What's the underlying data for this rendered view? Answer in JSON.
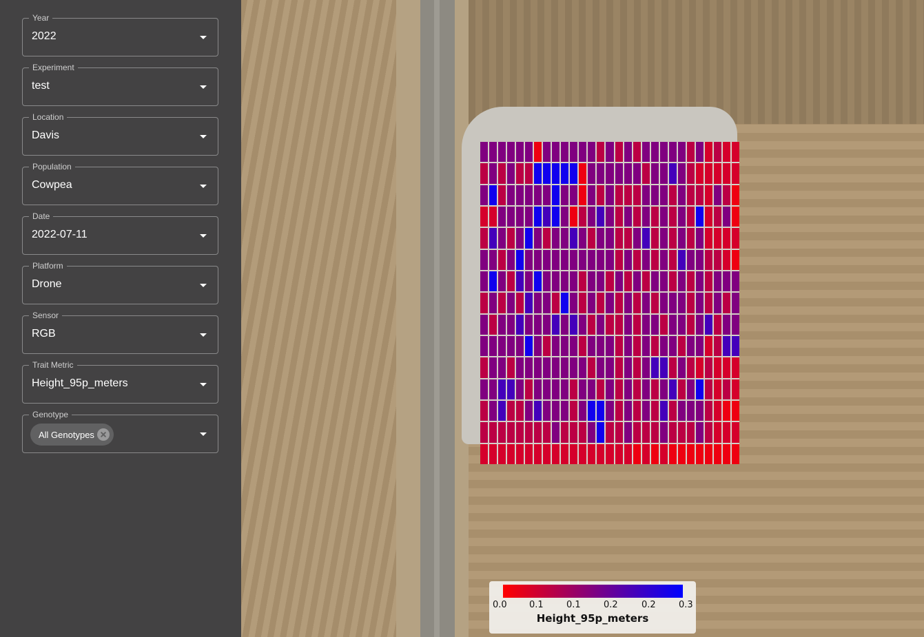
{
  "filters": [
    {
      "label": "Year",
      "value": "2022"
    },
    {
      "label": "Experiment",
      "value": "test"
    },
    {
      "label": "Location",
      "value": "Davis"
    },
    {
      "label": "Population",
      "value": "Cowpea"
    },
    {
      "label": "Date",
      "value": "2022-07-11"
    },
    {
      "label": "Platform",
      "value": "Drone"
    },
    {
      "label": "Sensor",
      "value": "RGB"
    },
    {
      "label": "Trait Metric",
      "value": "Height_95p_meters"
    }
  ],
  "genotype": {
    "label": "Genotype",
    "chip": "All Genotypes"
  },
  "icons": {
    "dropdown": "caret-down-icon",
    "chip_remove": "close-circle-icon"
  },
  "legend": {
    "title": "Height_95p_meters",
    "ticks": [
      "0.0",
      "0.1",
      "0.1",
      "0.2",
      "0.2",
      "0.3"
    ],
    "colors": {
      "low": "#ff0000",
      "mid": "#800080",
      "high": "#0000ff"
    }
  },
  "chart_data": {
    "type": "heatmap",
    "metric": "Height_95p_meters",
    "range": [
      0.0,
      0.3
    ],
    "rows": 15,
    "cols": 29,
    "values": [
      [
        0.15,
        0.15,
        0.15,
        0.15,
        0.15,
        0.15,
        0.02,
        0.15,
        0.15,
        0.15,
        0.15,
        0.15,
        0.15,
        0.08,
        0.15,
        0.08,
        0.15,
        0.08,
        0.15,
        0.15,
        0.15,
        0.15,
        0.15,
        0.08,
        0.15,
        0.05,
        0.08,
        0.05,
        0.05
      ],
      [
        0.08,
        0.15,
        0.08,
        0.15,
        0.08,
        0.08,
        0.28,
        0.28,
        0.28,
        0.28,
        0.28,
        0.02,
        0.15,
        0.15,
        0.15,
        0.15,
        0.15,
        0.15,
        0.08,
        0.15,
        0.15,
        0.22,
        0.15,
        0.08,
        0.05,
        0.05,
        0.05,
        0.05,
        0.05
      ],
      [
        0.15,
        0.28,
        0.08,
        0.15,
        0.15,
        0.15,
        0.15,
        0.15,
        0.28,
        0.15,
        0.15,
        0.02,
        0.15,
        0.08,
        0.15,
        0.08,
        0.08,
        0.08,
        0.15,
        0.15,
        0.15,
        0.08,
        0.15,
        0.08,
        0.08,
        0.05,
        0.15,
        0.08,
        0.02
      ],
      [
        0.05,
        0.05,
        0.15,
        0.15,
        0.15,
        0.15,
        0.28,
        0.22,
        0.28,
        0.15,
        0.02,
        0.08,
        0.15,
        0.22,
        0.15,
        0.08,
        0.15,
        0.08,
        0.15,
        0.08,
        0.15,
        0.08,
        0.15,
        0.08,
        0.28,
        0.05,
        0.08,
        0.15,
        0.02
      ],
      [
        0.08,
        0.22,
        0.15,
        0.08,
        0.15,
        0.28,
        0.15,
        0.08,
        0.15,
        0.15,
        0.22,
        0.15,
        0.08,
        0.15,
        0.15,
        0.08,
        0.08,
        0.15,
        0.22,
        0.08,
        0.15,
        0.08,
        0.15,
        0.08,
        0.15,
        0.05,
        0.05,
        0.05,
        0.05
      ],
      [
        0.15,
        0.15,
        0.08,
        0.15,
        0.28,
        0.15,
        0.15,
        0.15,
        0.15,
        0.15,
        0.15,
        0.15,
        0.15,
        0.15,
        0.15,
        0.08,
        0.15,
        0.08,
        0.15,
        0.08,
        0.15,
        0.08,
        0.22,
        0.15,
        0.15,
        0.08,
        0.08,
        0.05,
        0.02
      ],
      [
        0.15,
        0.28,
        0.15,
        0.08,
        0.22,
        0.15,
        0.28,
        0.15,
        0.15,
        0.15,
        0.15,
        0.08,
        0.15,
        0.15,
        0.08,
        0.15,
        0.08,
        0.15,
        0.08,
        0.15,
        0.15,
        0.08,
        0.15,
        0.08,
        0.15,
        0.08,
        0.15,
        0.15,
        0.15
      ],
      [
        0.08,
        0.15,
        0.08,
        0.15,
        0.08,
        0.22,
        0.15,
        0.15,
        0.08,
        0.28,
        0.15,
        0.08,
        0.15,
        0.08,
        0.15,
        0.08,
        0.15,
        0.08,
        0.15,
        0.08,
        0.15,
        0.15,
        0.15,
        0.08,
        0.15,
        0.08,
        0.15,
        0.08,
        0.15
      ],
      [
        0.15,
        0.08,
        0.15,
        0.15,
        0.22,
        0.15,
        0.15,
        0.15,
        0.22,
        0.15,
        0.22,
        0.15,
        0.08,
        0.15,
        0.08,
        0.08,
        0.15,
        0.08,
        0.15,
        0.15,
        0.08,
        0.15,
        0.15,
        0.08,
        0.15,
        0.22,
        0.08,
        0.15,
        0.15
      ],
      [
        0.15,
        0.15,
        0.15,
        0.15,
        0.15,
        0.28,
        0.15,
        0.08,
        0.15,
        0.15,
        0.15,
        0.08,
        0.15,
        0.15,
        0.15,
        0.08,
        0.15,
        0.08,
        0.15,
        0.08,
        0.15,
        0.15,
        0.08,
        0.15,
        0.15,
        0.05,
        0.08,
        0.22,
        0.22
      ],
      [
        0.08,
        0.15,
        0.15,
        0.08,
        0.15,
        0.15,
        0.15,
        0.15,
        0.15,
        0.15,
        0.15,
        0.15,
        0.08,
        0.15,
        0.15,
        0.08,
        0.15,
        0.08,
        0.15,
        0.22,
        0.22,
        0.08,
        0.15,
        0.08,
        0.05,
        0.08,
        0.05,
        0.05,
        0.05
      ],
      [
        0.15,
        0.15,
        0.22,
        0.22,
        0.15,
        0.08,
        0.15,
        0.15,
        0.15,
        0.15,
        0.08,
        0.15,
        0.15,
        0.08,
        0.15,
        0.08,
        0.15,
        0.08,
        0.15,
        0.08,
        0.15,
        0.22,
        0.08,
        0.15,
        0.28,
        0.08,
        0.05,
        0.08,
        0.05
      ],
      [
        0.08,
        0.15,
        0.22,
        0.08,
        0.08,
        0.15,
        0.22,
        0.15,
        0.15,
        0.15,
        0.08,
        0.15,
        0.28,
        0.28,
        0.15,
        0.08,
        0.15,
        0.08,
        0.15,
        0.08,
        0.22,
        0.08,
        0.15,
        0.15,
        0.15,
        0.08,
        0.05,
        0.02,
        0.02
      ],
      [
        0.08,
        0.08,
        0.08,
        0.08,
        0.08,
        0.08,
        0.08,
        0.08,
        0.15,
        0.08,
        0.08,
        0.08,
        0.15,
        0.28,
        0.08,
        0.08,
        0.15,
        0.08,
        0.08,
        0.08,
        0.15,
        0.08,
        0.08,
        0.08,
        0.15,
        0.08,
        0.05,
        0.05,
        0.05
      ],
      [
        0.05,
        0.05,
        0.05,
        0.05,
        0.05,
        0.05,
        0.05,
        0.05,
        0.05,
        0.05,
        0.05,
        0.05,
        0.05,
        0.05,
        0.05,
        0.05,
        0.05,
        0.02,
        0.05,
        0.02,
        0.05,
        0.02,
        0.02,
        0.02,
        0.02,
        0.02,
        0.02,
        0.02,
        0.02
      ]
    ]
  }
}
